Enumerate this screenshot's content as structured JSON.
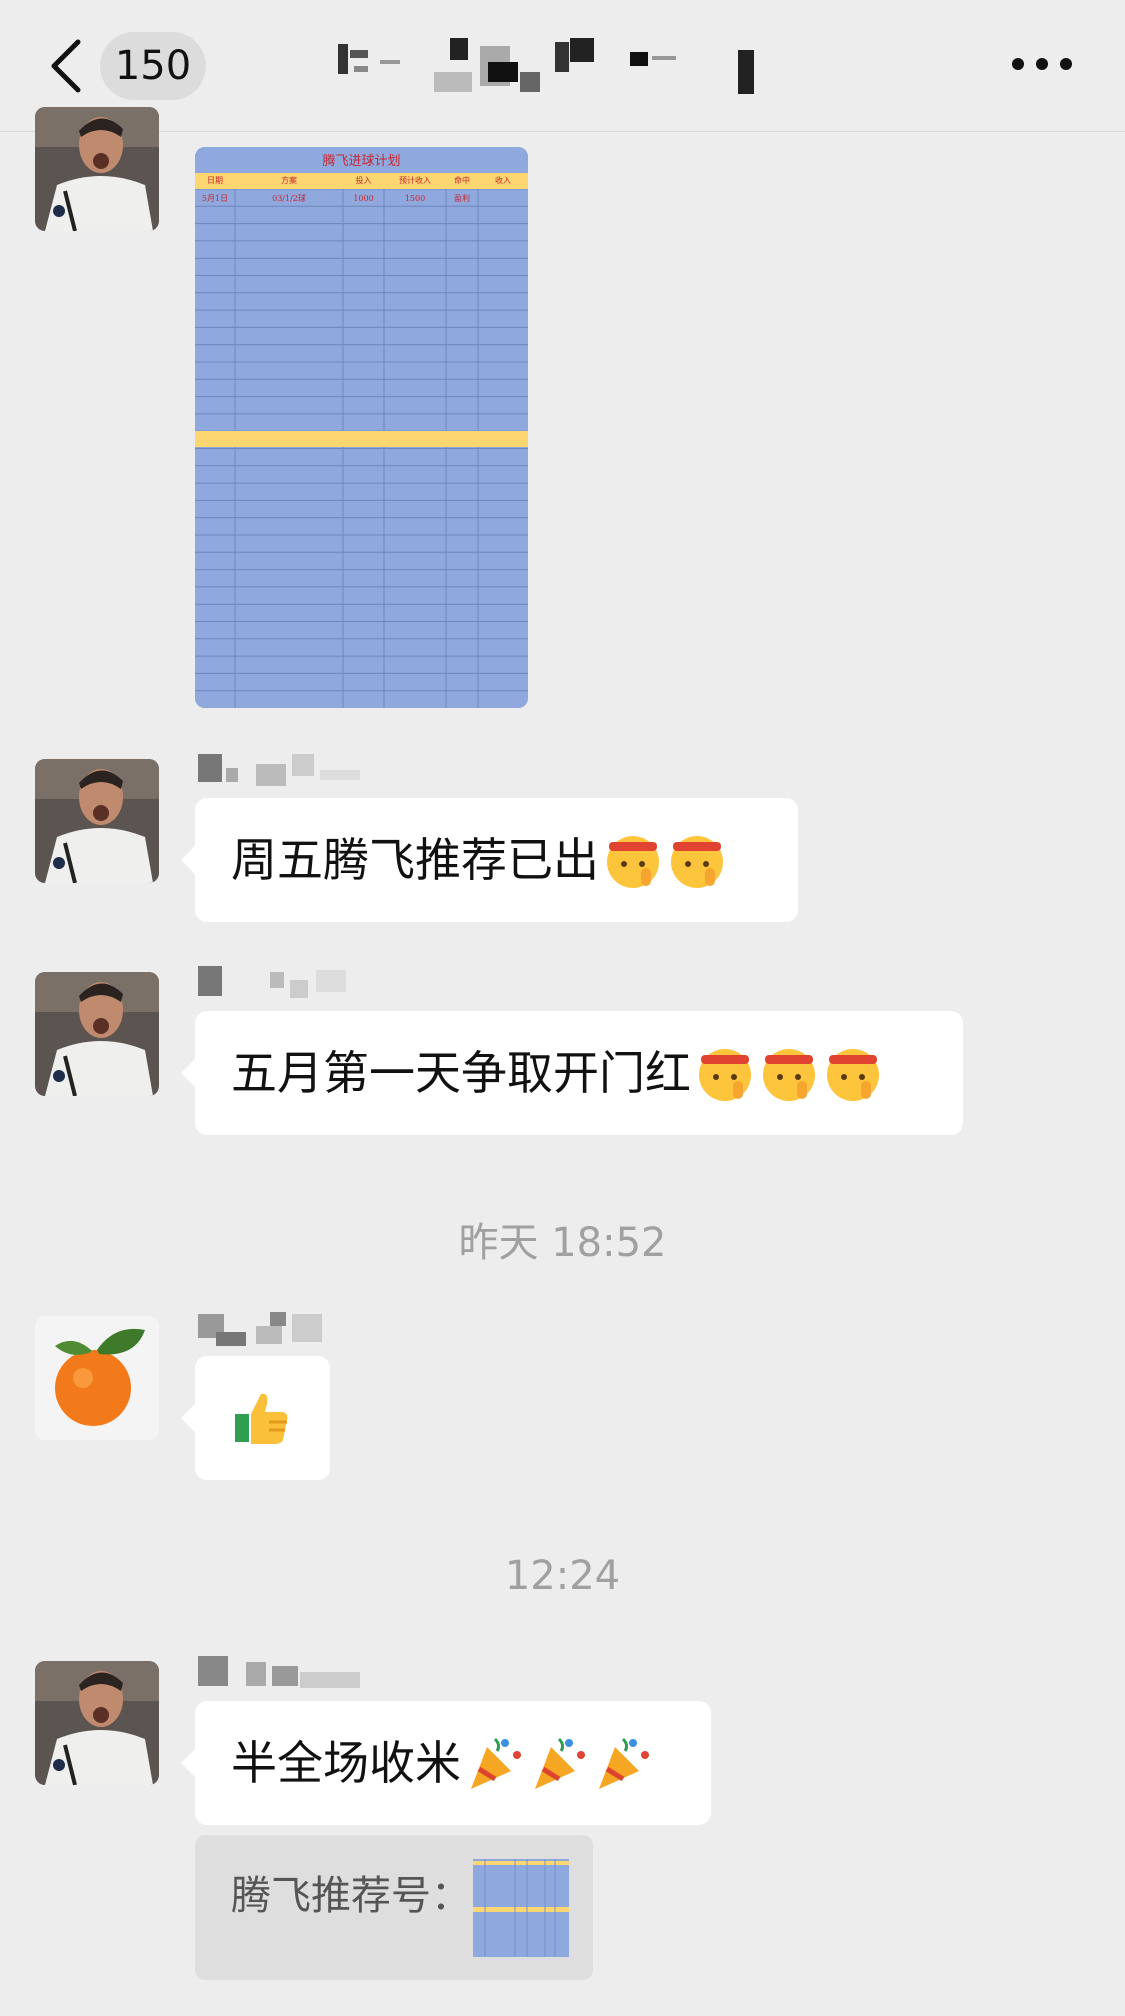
{
  "header": {
    "unread_count": "150",
    "title": ""
  },
  "messages": {
    "spreadsheet": {
      "title": "腾飞进球计划",
      "columns": [
        "日期",
        "方案",
        "投入",
        "预计收入",
        "命中",
        "收入"
      ],
      "first_row": [
        "5月1日",
        "03/1/2球",
        "1000",
        "1500",
        "盈利",
        ""
      ]
    },
    "m2": {
      "text": "周五腾飞推荐已出"
    },
    "m3": {
      "text": "五月第一天争取开门红"
    },
    "time1": "昨天 18:52",
    "time2": "12:24",
    "m5": {
      "text": "半全场收米"
    },
    "m6": {
      "text": "腾飞推荐号："
    }
  },
  "colors": {
    "background": "#ededed",
    "bubble": "#ffffff",
    "sheet_blue": "#8fa9df",
    "sheet_yellow": "#fcd771",
    "sheet_red": "#c8272f"
  },
  "icons": {
    "back": "chevron-left-icon",
    "more": "ellipsis-icon",
    "emoji_a": "shushing-headband-face-emoji",
    "emoji_b": "thumbs-up-emoji",
    "emoji_c": "party-popper-emoji"
  }
}
